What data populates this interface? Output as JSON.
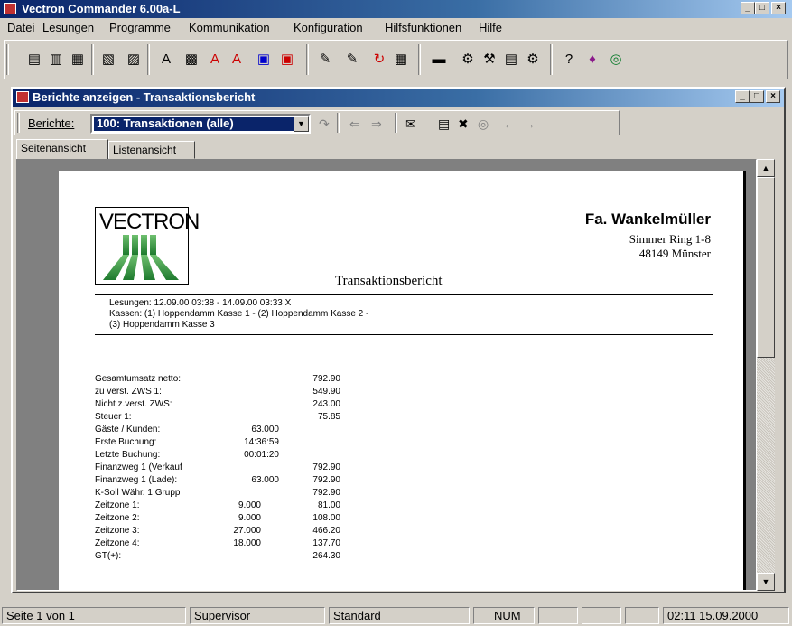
{
  "app": {
    "title": "Vectron Commander 6.00a-L",
    "window_buttons": [
      "_",
      "□",
      "×"
    ]
  },
  "menu": [
    "Datei",
    "Lesungen",
    "Programme",
    "Kommunikation",
    "Konfiguration",
    "Hilfsfunktionen",
    "Hilfe"
  ],
  "toolbar_icons": [
    "report-icon",
    "print-report-icon",
    "preview-icon",
    "edit-icon",
    "export-icon",
    "font-icon",
    "printer-icon",
    "print-a-icon",
    "print-b-icon",
    "memory-icon",
    "memory-export-icon",
    "wand-icon",
    "wand-alt-icon",
    "refresh-icon",
    "calc-icon",
    "register-icon",
    "users-icon",
    "tools-icon",
    "terminal-icon",
    "settings-icon",
    "help-icon",
    "book-icon",
    "globe-icon"
  ],
  "toolbar_glyphs": [
    "▤",
    "▥",
    "▦",
    "▧",
    "▨",
    "A",
    "▩",
    "A",
    "A",
    "▣",
    "▣",
    "✎",
    "✎",
    "↻",
    "▦",
    "▬",
    "⚙",
    "⚒",
    "▤",
    "⚙",
    "?",
    "♦",
    "◎"
  ],
  "child": {
    "title": "Berichte anzeigen - Transaktionsbericht",
    "reports_label": "Berichte:",
    "selected_report": "100: Transaktionen (alle)",
    "tabs": [
      "Seitenansicht",
      "Listenansicht"
    ]
  },
  "report": {
    "logo_text": "VECTRON",
    "company": "Fa. Wankelmüller",
    "street": "Simmer Ring 1-8",
    "city": "48149 Münster",
    "title": "Transaktionsbericht",
    "header_lines": [
      "Lesungen: 12.09.00 03:38 - 14.09.00 03:33  X",
      "Kassen: (1) Hoppendamm Kasse 1  -  (2) Hoppendamm Kasse 2  -",
      "(3) Hoppendamm Kasse 3"
    ],
    "rows": [
      {
        "label": "Gesamtumsatz netto:",
        "count": "",
        "amount": "792.90"
      },
      {
        "label": "zu verst. ZWS 1:",
        "count": "",
        "amount": "549.90"
      },
      {
        "label": "Nicht z.verst. ZWS:",
        "count": "",
        "amount": "243.00"
      },
      {
        "label": "Steuer 1:",
        "count": "",
        "amount": "75.85"
      },
      {
        "label": "Gäste / Kunden:",
        "count": "63.000",
        "amount": ""
      },
      {
        "label": "Erste Buchung:",
        "count": "14:36:59",
        "amount": ""
      },
      {
        "label": "Letzte Buchung:",
        "count": "00:01:20",
        "amount": ""
      },
      {
        "label": "Finanzweg 1 (Verkauf",
        "count": "",
        "amount": "792.90"
      },
      {
        "label": "Finanzweg 1 (Lade):",
        "count": "63.000",
        "amount": "792.90"
      },
      {
        "label": "K-Soll Währ. 1 Grupp",
        "count": "",
        "amount": "792.90"
      },
      {
        "label": "Zeitzone 1:",
        "count": "9.000",
        "amount": "81.00"
      },
      {
        "label": "Zeitzone 2:",
        "count": "9.000",
        "amount": "108.00"
      },
      {
        "label": "Zeitzone 3:",
        "count": "27.000",
        "amount": "466.20"
      },
      {
        "label": "Zeitzone 4:",
        "count": "18.000",
        "amount": "137.70"
      },
      {
        "label": "GT(+):",
        "count": "",
        "amount": "264.30"
      }
    ]
  },
  "status": {
    "page": "Seite 1 von 1",
    "user": "Supervisor",
    "profile": "Standard",
    "num": "NUM",
    "datetime": "02:11  15.09.2000"
  }
}
